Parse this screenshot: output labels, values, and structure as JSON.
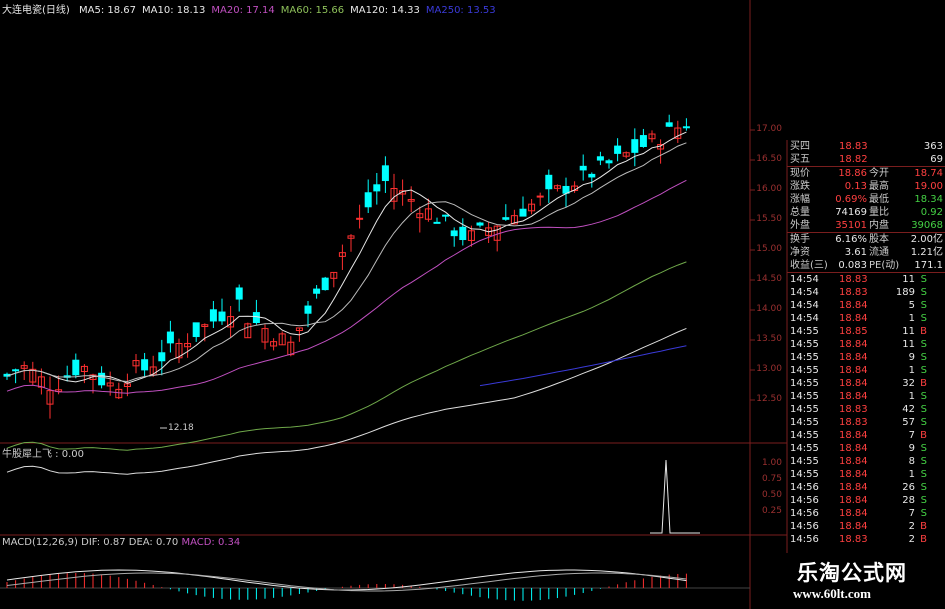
{
  "header": {
    "title": "大连电瓷(日线)",
    "ma": [
      {
        "label": "MA5: 18.67",
        "color": "#e8e8e8"
      },
      {
        "label": "MA10: 18.13",
        "color": "#e8e8e8"
      },
      {
        "label": "MA20: 17.14",
        "color": "#c050c0"
      },
      {
        "label": "MA60: 15.66",
        "color": "#8ec05a"
      },
      {
        "label": "MA120: 14.33",
        "color": "#e8e8e8"
      },
      {
        "label": "MA250: 13.53",
        "color": "#3a3ad8"
      }
    ]
  },
  "price_axis": [
    "17.00",
    "16.50",
    "16.00",
    "15.50",
    "15.00",
    "14.50",
    "14.00",
    "13.50",
    "13.00",
    "12.50"
  ],
  "price_range": [
    12.25,
    17.25
  ],
  "low_label": "12.18",
  "indicator": {
    "label": "牛股犀上飞 : 0.00",
    "axis": [
      "1.00",
      "0.75",
      "0.50",
      "0.25"
    ]
  },
  "macd": {
    "label": "MACD(12,26,9)  DIF: 0.87  DEA: 0.70",
    "macd_value": "MACD: 0.34"
  },
  "quote": [
    {
      "name": "买四",
      "value": "18.83",
      "extra": "363",
      "vcolor": "#ff4040",
      "ecolor": "#e8e8e8"
    },
    {
      "name": "买五",
      "value": "18.82",
      "extra": "69",
      "vcolor": "#ff4040",
      "ecolor": "#e8e8e8"
    }
  ],
  "stats": [
    {
      "l1": "现价",
      "v1": "18.86",
      "l2": "今开",
      "v2": "18.74",
      "c1": "#ff4040",
      "c2": "#ff4040"
    },
    {
      "l1": "涨跌",
      "v1": "0.13",
      "l2": "最高",
      "v2": "19.00",
      "c1": "#ff4040",
      "c2": "#ff4040"
    },
    {
      "l1": "涨幅",
      "v1": "0.69%",
      "l2": "最低",
      "v2": "18.34",
      "c1": "#ff4040",
      "c2": "#44d044"
    },
    {
      "l1": "总量",
      "v1": "74169",
      "l2": "量比",
      "v2": "0.92",
      "c1": "#e8e8e8",
      "c2": "#44d044"
    },
    {
      "l1": "外盘",
      "v1": "35101",
      "l2": "内盘",
      "v2": "39068",
      "c1": "#ff4040",
      "c2": "#44d044"
    }
  ],
  "stats2": [
    {
      "l1": "换手",
      "v1": "6.16%",
      "l2": "股本",
      "v2": "2.00亿"
    },
    {
      "l1": "净资",
      "v1": "3.61",
      "l2": "流通",
      "v2": "1.21亿"
    },
    {
      "l1": "收益(三)",
      "v1": "0.083",
      "l2": "PE(动)",
      "v2": "171.1"
    }
  ],
  "ticks": [
    {
      "t": "14:54",
      "p": "18.83",
      "v": "11",
      "d": "S"
    },
    {
      "t": "14:54",
      "p": "18.83",
      "v": "189",
      "d": "S"
    },
    {
      "t": "14:54",
      "p": "18.84",
      "v": "5",
      "d": "S"
    },
    {
      "t": "14:54",
      "p": "18.84",
      "v": "1",
      "d": "S"
    },
    {
      "t": "14:55",
      "p": "18.85",
      "v": "11",
      "d": "B"
    },
    {
      "t": "14:55",
      "p": "18.84",
      "v": "11",
      "d": "S"
    },
    {
      "t": "14:55",
      "p": "18.84",
      "v": "9",
      "d": "S"
    },
    {
      "t": "14:55",
      "p": "18.84",
      "v": "1",
      "d": "S"
    },
    {
      "t": "14:55",
      "p": "18.84",
      "v": "32",
      "d": "B"
    },
    {
      "t": "14:55",
      "p": "18.84",
      "v": "1",
      "d": "S"
    },
    {
      "t": "14:55",
      "p": "18.83",
      "v": "42",
      "d": "S"
    },
    {
      "t": "14:55",
      "p": "18.83",
      "v": "57",
      "d": "S"
    },
    {
      "t": "14:55",
      "p": "18.84",
      "v": "7",
      "d": "B"
    },
    {
      "t": "14:55",
      "p": "18.84",
      "v": "9",
      "d": "S"
    },
    {
      "t": "14:55",
      "p": "18.84",
      "v": "8",
      "d": "S"
    },
    {
      "t": "14:55",
      "p": "18.84",
      "v": "1",
      "d": "S"
    },
    {
      "t": "14:56",
      "p": "18.84",
      "v": "26",
      "d": "S"
    },
    {
      "t": "14:56",
      "p": "18.84",
      "v": "28",
      "d": "S"
    },
    {
      "t": "14:56",
      "p": "18.84",
      "v": "7",
      "d": "S"
    },
    {
      "t": "14:56",
      "p": "18.84",
      "v": "2",
      "d": "B"
    },
    {
      "t": "14:56",
      "p": "18.83",
      "v": "2",
      "d": "B"
    }
  ],
  "watermark": {
    "name": "乐淘公式网",
    "url": "www.60lt.com"
  },
  "colors": {
    "up": "#ff3030",
    "down": "#00ffff",
    "grid": "#7a1e1e",
    "buy": "#ff4040",
    "sell": "#44d044"
  }
}
